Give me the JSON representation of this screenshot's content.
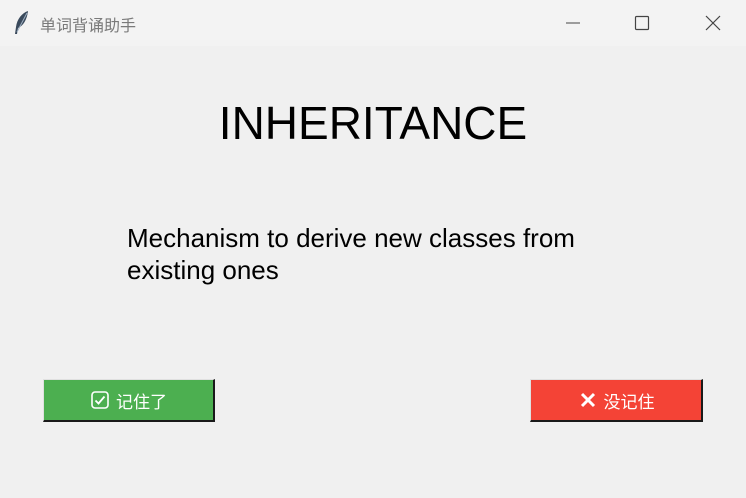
{
  "window": {
    "title": "单词背诵助手",
    "controls": {
      "minimize_icon": "minimize-icon",
      "maximize_icon": "maximize-icon",
      "close_icon": "close-icon"
    }
  },
  "card": {
    "word": "INHERITANCE",
    "definition": "Mechanism to derive new classes from existing ones"
  },
  "actions": {
    "remember": {
      "label": "记住了",
      "icon": "checkbox-icon",
      "color": "#4caf50"
    },
    "forgot": {
      "label": "没记住",
      "icon": "x-icon",
      "color": "#f44336"
    }
  }
}
